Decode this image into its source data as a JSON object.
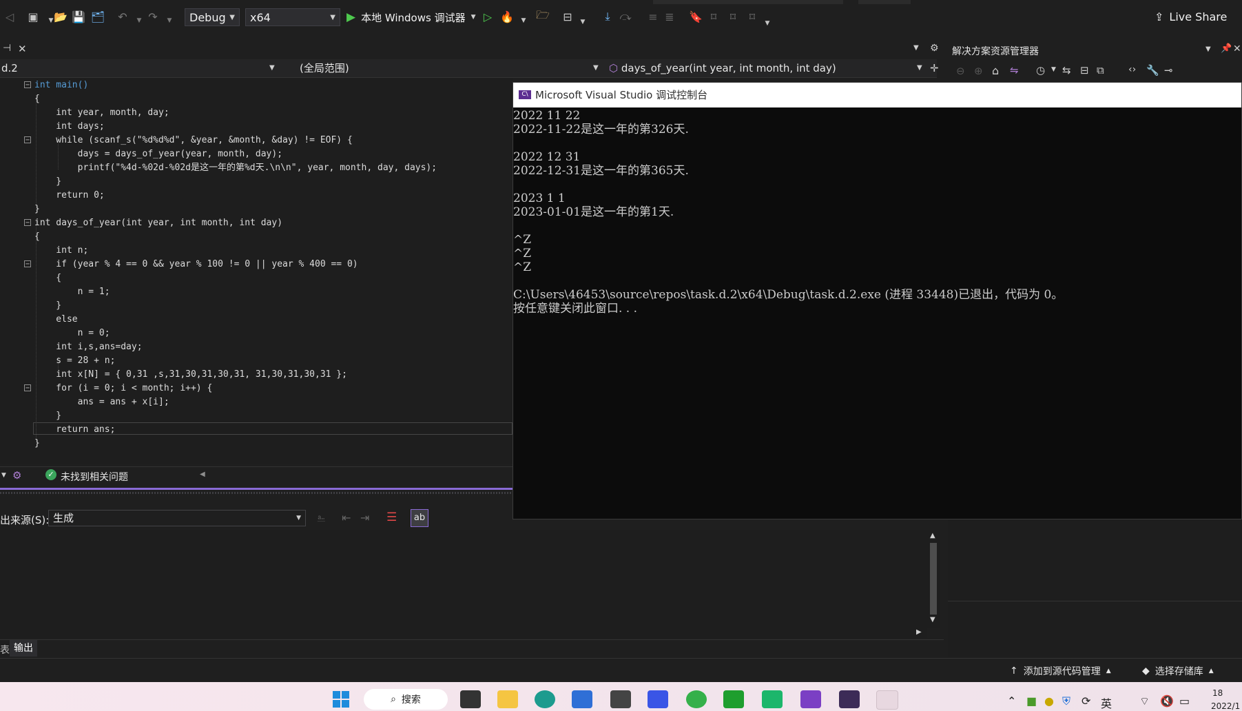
{
  "toolbar": {
    "config": "Debug",
    "platform": "x64",
    "debugger": "本地 Windows 调试器",
    "live_share": "Live Share"
  },
  "editor": {
    "tab_name": "d.2",
    "scope": "(全局范围)",
    "function": "days_of_year(int year, int month, int day)",
    "status": "未找到相关问题"
  },
  "code_lines": [
    "int main()",
    "{",
    "    int year, month, day;",
    "    int days;",
    "    while (scanf_s(\"%d%d%d\", &year, &month, &day) != EOF) {",
    "        days = days_of_year(year, month, day);",
    "        printf(\"%4d-%02d-%02d是这一年的第%d天.\\n\\n\", year, month, day, days);",
    "    }",
    "    return 0;",
    "}",
    "int days_of_year(int year, int month, int day)",
    "{",
    "    int n;",
    "    if (year % 4 == 0 && year % 100 != 0 || year % 400 == 0)",
    "    {",
    "        n = 1;",
    "    }",
    "    else",
    "        n = 0;",
    "    int i,s,ans=day;",
    "    s = 28 + n;",
    "    int x[N] = { 0,31 ,s,31,30,31,30,31, 31,30,31,30,31 };",
    "    for (i = 0; i < month; i++) {",
    "        ans = ans + x[i];",
    "    }",
    "    return ans;",
    "}"
  ],
  "console": {
    "title": "Microsoft Visual Studio 调试控制台",
    "lines": [
      "2022 11 22",
      "2022-11-22是这一年的第326天.",
      "",
      "2022 12 31",
      "2022-12-31是这一年的第365天.",
      "",
      "2023 1 1",
      "2023-01-01是这一年的第1天.",
      "",
      "^Z",
      "^Z",
      "^Z",
      "",
      "C:\\Users\\46453\\source\\repos\\task.d.2\\x64\\Debug\\task.d.2.exe (进程 33448)已退出，代码为 0。",
      "按任意键关闭此窗口. . ."
    ]
  },
  "output": {
    "source_label": "出来源(S):",
    "source_value": "生成",
    "tab_left": "表",
    "tab_output": "输出"
  },
  "solution_explorer": {
    "title": "解决方案资源管理器"
  },
  "statusbar": {
    "add_source_control": "添加到源代码管理",
    "select_repo": "选择存储库"
  },
  "taskbar": {
    "search": "搜索",
    "ime": "英",
    "clock_time": "18",
    "clock_date": "2022/1"
  }
}
